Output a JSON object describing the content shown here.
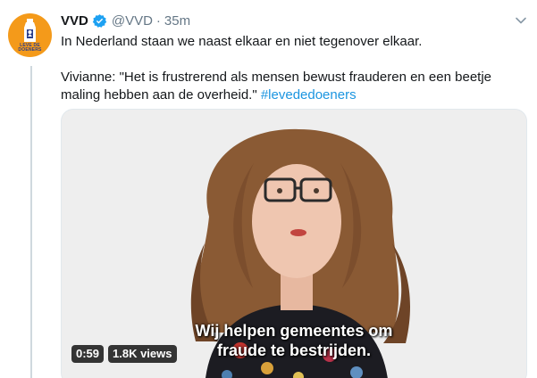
{
  "tweet": {
    "author_name": "VVD",
    "handle": "@VVD",
    "separator": "·",
    "time": "35m",
    "line1": "In Nederland staan we naast elkaar en niet tegenover elkaar.",
    "line2_prefix": "Vivianne: \"Het is frustrerend als mensen bewust frauderen en een beetje maling hebben aan de overheid.\" ",
    "hashtag": "#levededoeners",
    "avatar_text_line1": "LEVE DE",
    "avatar_text_line2": "DOENERS"
  },
  "video": {
    "subtitle_line1": "Wij helpen gemeentes om",
    "subtitle_line2": "fraude te bestrijden.",
    "duration": "0:59",
    "views": "1.8K views"
  },
  "colors": {
    "accent": "#1b95e0",
    "avatar_bg": "#f49a1a",
    "verified": "#1da1f2",
    "secondary_text": "#657786"
  },
  "icons": [
    "verified-badge-icon",
    "chevron-down-icon",
    "avatar-logo"
  ]
}
